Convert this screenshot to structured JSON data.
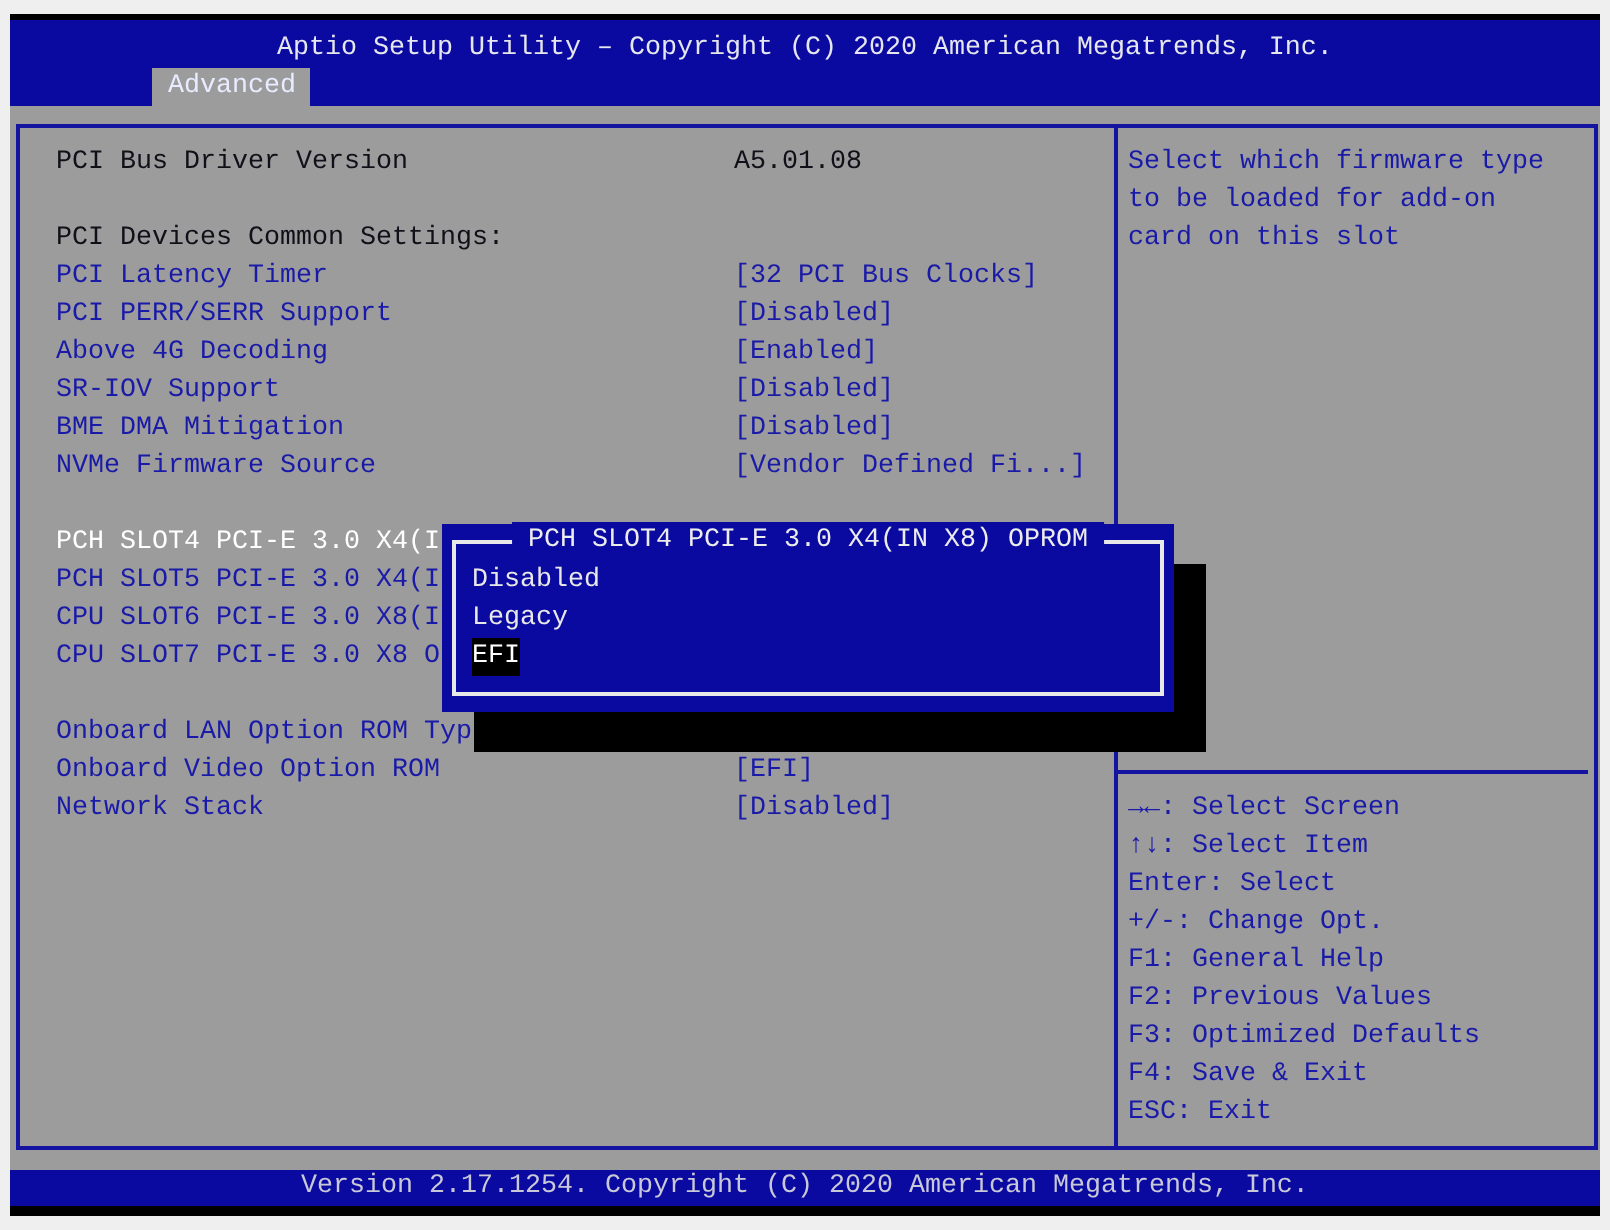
{
  "window": {
    "title": "Aptio Setup Utility – Copyright (C) 2020 American Megatrends, Inc.",
    "tabs": [
      {
        "label": "Advanced",
        "selected": true
      }
    ]
  },
  "settings": {
    "sections": [
      [
        {
          "kind": "info",
          "label": "PCI Bus Driver Version",
          "value": "A5.01.08"
        }
      ],
      [
        {
          "kind": "heading",
          "label": "PCI Devices Common Settings:"
        },
        {
          "kind": "option",
          "label": "PCI Latency Timer",
          "value": "[32 PCI Bus Clocks]",
          "selected": false
        },
        {
          "kind": "option",
          "label": "PCI PERR/SERR Support",
          "value": "[Disabled]",
          "selected": false
        },
        {
          "kind": "option",
          "label": "Above 4G Decoding",
          "value": "[Enabled]",
          "selected": false
        },
        {
          "kind": "option",
          "label": "SR-IOV Support",
          "value": "[Disabled]",
          "selected": false
        },
        {
          "kind": "option",
          "label": "BME DMA Mitigation",
          "value": "[Disabled]",
          "selected": false
        },
        {
          "kind": "option",
          "label": "NVMe Firmware Source",
          "value": "[Vendor Defined Fi...]",
          "selected": false
        }
      ],
      [
        {
          "kind": "option",
          "label": "PCH SLOT4 PCI-E 3.0 X4(I",
          "selected": true
        },
        {
          "kind": "option",
          "label": "PCH SLOT5 PCI-E 3.0 X4(I",
          "selected": false
        },
        {
          "kind": "option",
          "label": "CPU SLOT6 PCI-E 3.0 X8(I",
          "selected": false
        },
        {
          "kind": "option",
          "label": "CPU SLOT7 PCI-E 3.0 X8 O",
          "selected": false
        }
      ],
      [
        {
          "kind": "option",
          "label": "Onboard LAN Option ROM Typ",
          "selected": false
        },
        {
          "kind": "option",
          "label": "Onboard Video Option ROM",
          "value": "[EFI]",
          "selected": false
        },
        {
          "kind": "option",
          "label": "Network Stack",
          "value": "[Disabled]",
          "selected": false
        }
      ]
    ]
  },
  "popup": {
    "title": "PCH SLOT4 PCI-E 3.0 X4(IN X8) OPROM",
    "options": [
      {
        "label": "Disabled",
        "selected": false
      },
      {
        "label": "Legacy",
        "selected": false
      },
      {
        "label": "EFI",
        "selected": true
      }
    ]
  },
  "help": {
    "description": "Select which firmware type to be loaded for add-on card on this slot",
    "keys": [
      "→←: Select Screen",
      "↑↓: Select Item",
      "Enter: Select",
      "+/-: Change Opt.",
      "F1: General Help",
      "F2: Previous Values",
      "F3: Optimized Defaults",
      "F4: Save & Exit",
      "ESC: Exit"
    ]
  },
  "status_bar": {
    "text": "Version 2.17.1254. Copyright (C) 2020 American Megatrends, Inc."
  }
}
